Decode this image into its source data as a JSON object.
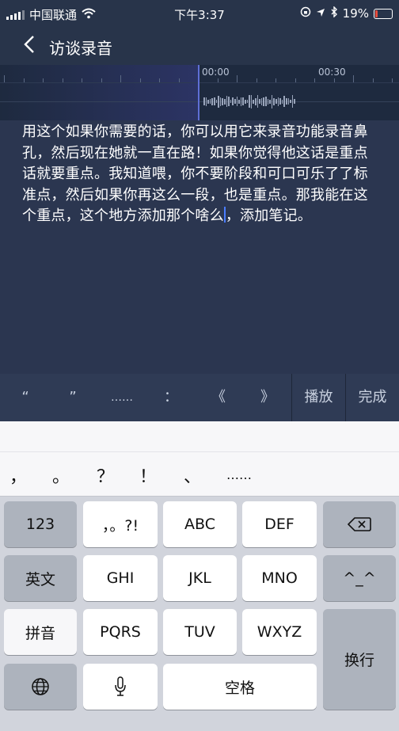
{
  "status_bar": {
    "carrier": "中国联通",
    "time": "下午3:37",
    "battery": "19%",
    "battery_level": 0.19,
    "icons": [
      "signal-icon",
      "wifi-icon",
      "rotation-lock-icon",
      "location-icon",
      "bluetooth-icon",
      "battery-icon"
    ]
  },
  "nav": {
    "back_glyph": "〈",
    "title": "访谈录音"
  },
  "waveform": {
    "labels": [
      "00:00",
      "00:30"
    ]
  },
  "transcript": {
    "before_cursor": "用这个如果你需要的话，你可以用它来录音功能录音鼻孔，然后现在她就一直在路！如果你觉得他这话是重点话就要重点。我知道喂，你不要阶段和可口可乐了了标准点，然后如果你再这么一段，也是重点。那我能在这个重点，这个地方添加那个啥么",
    "after_cursor": "，添加笔记。"
  },
  "accessory": {
    "left_quote": "“",
    "right_quote": "”",
    "ellipsis": "……",
    "colon": "：",
    "left_book": "《",
    "right_book": "》",
    "play": "播放",
    "done": "完成"
  },
  "keyboard": {
    "candidates": [
      "，",
      "。",
      "？",
      "！",
      "、",
      "……"
    ],
    "keys": {
      "num": "123",
      "punct": "，。?!",
      "abc": "ABC",
      "def": "DEF",
      "english": "英文",
      "ghi": "GHI",
      "jkl": "JKL",
      "mno": "MNO",
      "emoji": "^_^",
      "pinyin": "拼音",
      "pqrs": "PQRS",
      "tuv": "TUV",
      "wxyz": "WXYZ",
      "enter": "换行",
      "space": "空格"
    }
  }
}
